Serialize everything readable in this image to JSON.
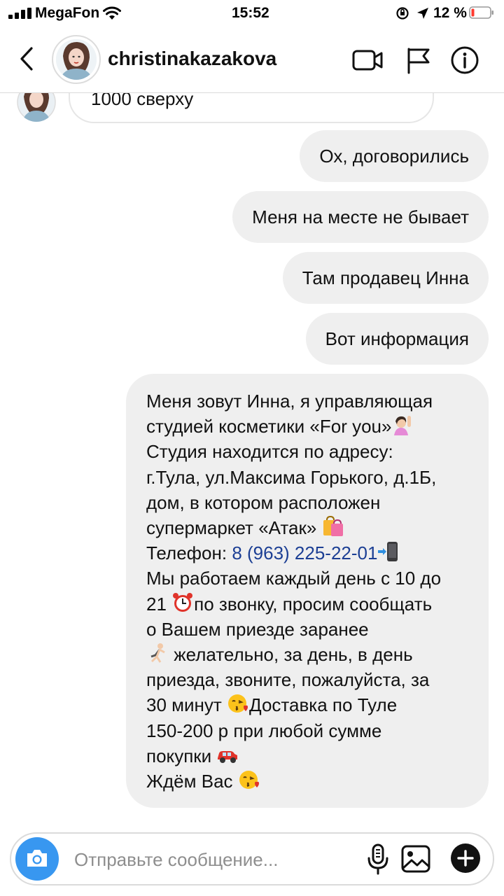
{
  "status_bar": {
    "carrier": "MegaFon",
    "time": "15:52",
    "battery": "12 %"
  },
  "header": {
    "username": "christinakazakova",
    "icons": [
      "back-icon",
      "video-call-icon",
      "flag-icon",
      "info-icon"
    ]
  },
  "incoming_partial": {
    "text": "1000 сверху"
  },
  "messages": [
    {
      "text": "Ох, договорились"
    },
    {
      "text": "Меня на месте не бывает"
    },
    {
      "text": "Там продавец Инна"
    },
    {
      "text": "Вот информация"
    }
  ],
  "info_message": {
    "l1": "Меня зовут Инна, я управляющая",
    "l2": "студией косметики «For you»",
    "l3": "Студия  находится по адресу:",
    "l4": "г.Тула, ул.Максима Горького, д.1Б,",
    "l5": "дом, в котором расположен",
    "l6": "супермаркет «Атак» ",
    "l7_label": "Телефон: ",
    "l7_phone": "8 (963) 225-22-01",
    "l8": "Мы работаем каждый день с 10 до",
    "l9a": "21 ",
    "l9b": "по звонку, просим сообщать",
    "l10": "о Вашем приезде заранее",
    "l11": " желательно, за день, в день",
    "l12": "приезда, звоните, пожалуйста, за",
    "l13a": "30 минут  ",
    "l13b": "Доставка по Туле",
    "l14": "150-200 р при любой сумме",
    "l15": "покупки ",
    "l16": "Ждём Вас "
  },
  "composer": {
    "placeholder": "Отправьте сообщение..."
  },
  "colors": {
    "outgoing_bubble": "#efefef",
    "camera_button": "#3897f0",
    "phone_link": "#1c3f94",
    "divider": "#dbdbdb"
  }
}
